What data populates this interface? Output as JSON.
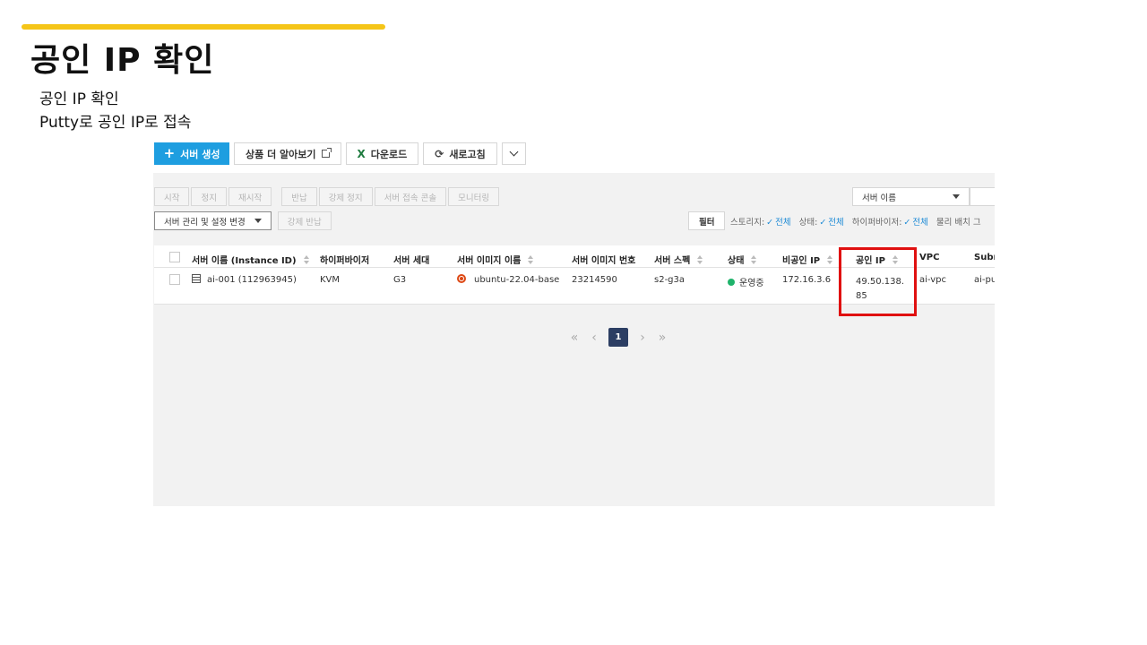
{
  "slide": {
    "title": "공인 IP 확인",
    "bullets": [
      "공인 IP 확인",
      "Putty로 공인 IP로 접속"
    ]
  },
  "toolbar": {
    "create_server": "서버 생성",
    "learn_more": "상품 더 알아보기",
    "download": "다운로드",
    "refresh": "새로고침"
  },
  "actions": [
    "시작",
    "정지",
    "재시작",
    "반납",
    "강제 정지",
    "서버 접속 콘솔",
    "모니터링"
  ],
  "management": {
    "settings_change": "서버 관리 및 설정 변경",
    "force_return": "강제 반납"
  },
  "search": {
    "selected": "서버 이름"
  },
  "filter": {
    "label": "필터",
    "storage_label": "스토리지:",
    "storage_value": "전체",
    "status_label": "상태:",
    "status_value": "전체",
    "hypervisor_label": "하이퍼바이저:",
    "hypervisor_value": "전체",
    "physical_label": "물리 배치 그"
  },
  "table": {
    "headers": {
      "name": "서버 이름 (Instance ID)",
      "hypervisor": "하이퍼바이저",
      "generation": "서버 세대",
      "image_name": "서버 이미지 이름",
      "image_number": "서버 이미지 번호",
      "spec": "서버 스펙",
      "status": "상태",
      "private_ip": "비공인 IP",
      "public_ip": "공인 IP",
      "vpc": "VPC",
      "subnet": "Subn"
    },
    "rows": [
      {
        "name": "ai-001 (112963945)",
        "hypervisor": "KVM",
        "generation": "G3",
        "image_name": "ubuntu-22.04-base",
        "image_number": "23214590",
        "spec": "s2-g3a",
        "status": "운영중",
        "private_ip": "172.16.3.6",
        "public_ip": "49.50.138.85",
        "vpc": "ai-vpc",
        "subnet": "ai-pul"
      }
    ]
  },
  "pagination": {
    "current": "1"
  },
  "colors": {
    "accent_bar": "#f5c518",
    "primary_button": "#1e9ee0",
    "highlight_box": "#e01010",
    "status_running": "#1fb36b",
    "active_page": "#2c3e63"
  }
}
